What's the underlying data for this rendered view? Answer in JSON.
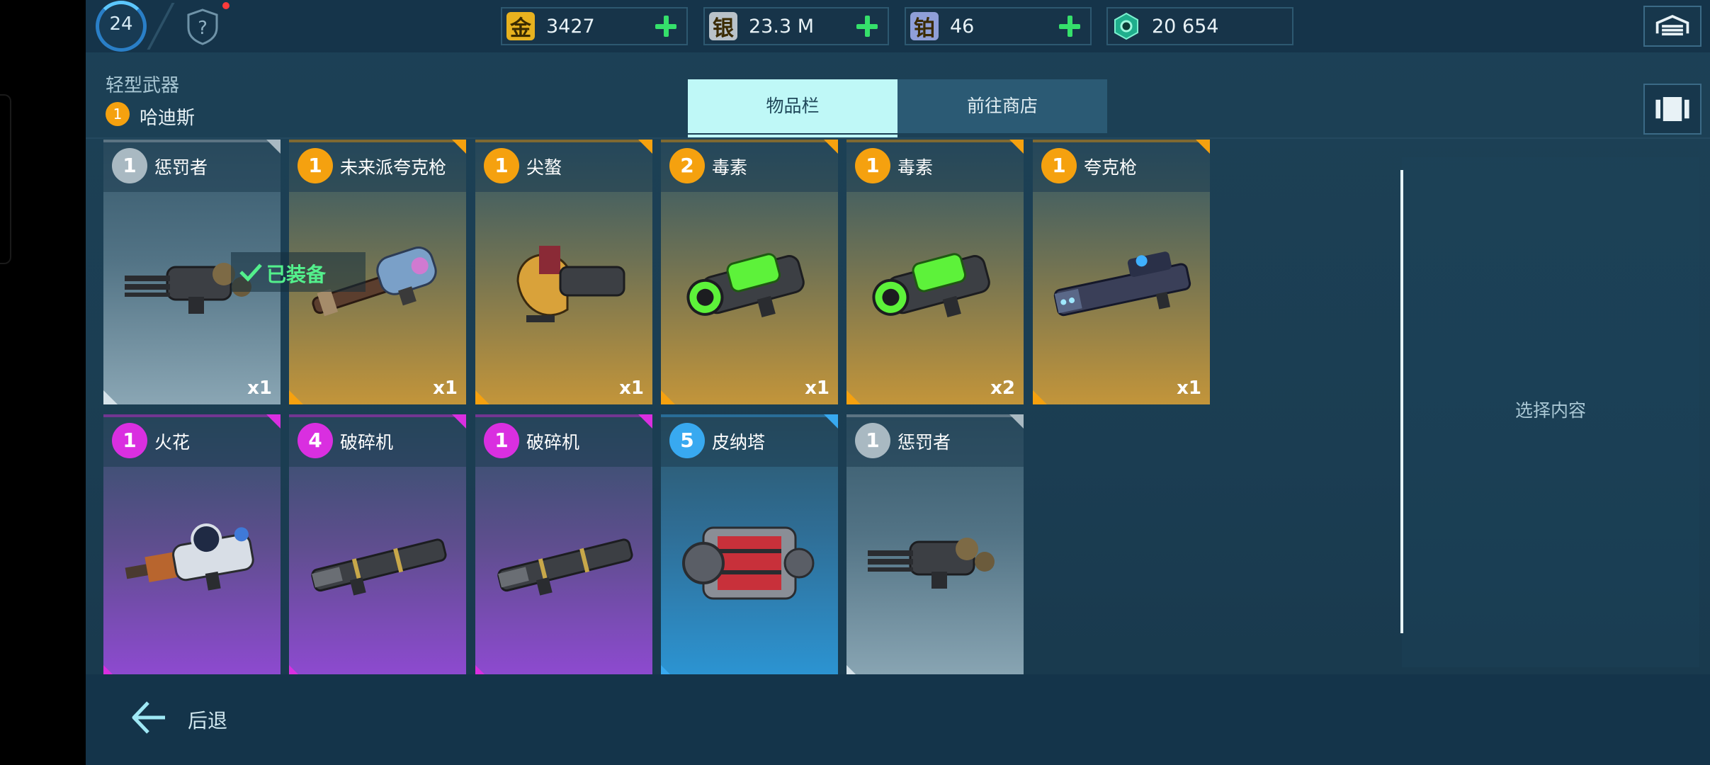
{
  "topbar": {
    "level": "24",
    "currencies": [
      {
        "icon": "gold-coin-icon",
        "glyph": "金",
        "value": "3427",
        "color": "#e8b21f"
      },
      {
        "icon": "silver-coin-icon",
        "glyph": "银",
        "value": "23.3 M",
        "color": "#b9c2c9"
      },
      {
        "icon": "platinum-coin-icon",
        "glyph": "铂",
        "value": "46",
        "color": "#8f9fd8"
      },
      {
        "icon": "key-token-icon",
        "glyph": "",
        "value": "20 654",
        "color": "#26c9a6"
      }
    ]
  },
  "header": {
    "category": "轻型武器",
    "character_level": "1",
    "character_name": "哈迪斯"
  },
  "tabs": {
    "inventory": "物品栏",
    "shop": "前往商店"
  },
  "equipped_label": "已装备",
  "items": [
    {
      "level": "1",
      "name": "惩罚者",
      "qty": "x1",
      "rarity": "gray",
      "icon": "minigun-weapon-icon"
    },
    {
      "level": "1",
      "name": "未来派夸克枪",
      "qty": "x1",
      "rarity": "orange",
      "icon": "quark-gun-weapon-icon"
    },
    {
      "level": "1",
      "name": "尖螯",
      "qty": "x1",
      "rarity": "orange",
      "icon": "pincer-weapon-icon"
    },
    {
      "level": "2",
      "name": "毒素",
      "qty": "x1",
      "rarity": "orange",
      "icon": "toxin-weapon-icon"
    },
    {
      "level": "1",
      "name": "毒素",
      "qty": "x2",
      "rarity": "orange",
      "icon": "toxin-weapon-icon"
    },
    {
      "level": "1",
      "name": "夸克枪",
      "qty": "x1",
      "rarity": "orange",
      "icon": "quark-rifle-weapon-icon"
    },
    {
      "level": "1",
      "name": "火花",
      "qty": "",
      "rarity": "purple",
      "icon": "spark-weapon-icon"
    },
    {
      "level": "4",
      "name": "破碎机",
      "qty": "",
      "rarity": "purple",
      "icon": "shredder-weapon-icon"
    },
    {
      "level": "1",
      "name": "破碎机",
      "qty": "",
      "rarity": "purple",
      "icon": "shredder-weapon-icon"
    },
    {
      "level": "5",
      "name": "皮纳塔",
      "qty": "",
      "rarity": "blue",
      "icon": "pinata-weapon-icon"
    },
    {
      "level": "1",
      "name": "惩罚者",
      "qty": "",
      "rarity": "gray",
      "icon": "minigun-weapon-icon"
    }
  ],
  "rarity_colors": {
    "gray": "#a9b9c2",
    "orange": "#f5a10f",
    "purple": "#d92fe0",
    "blue": "#38a9f0"
  },
  "right_panel": {
    "hint": "选择内容"
  },
  "bottom": {
    "back": "后退"
  }
}
